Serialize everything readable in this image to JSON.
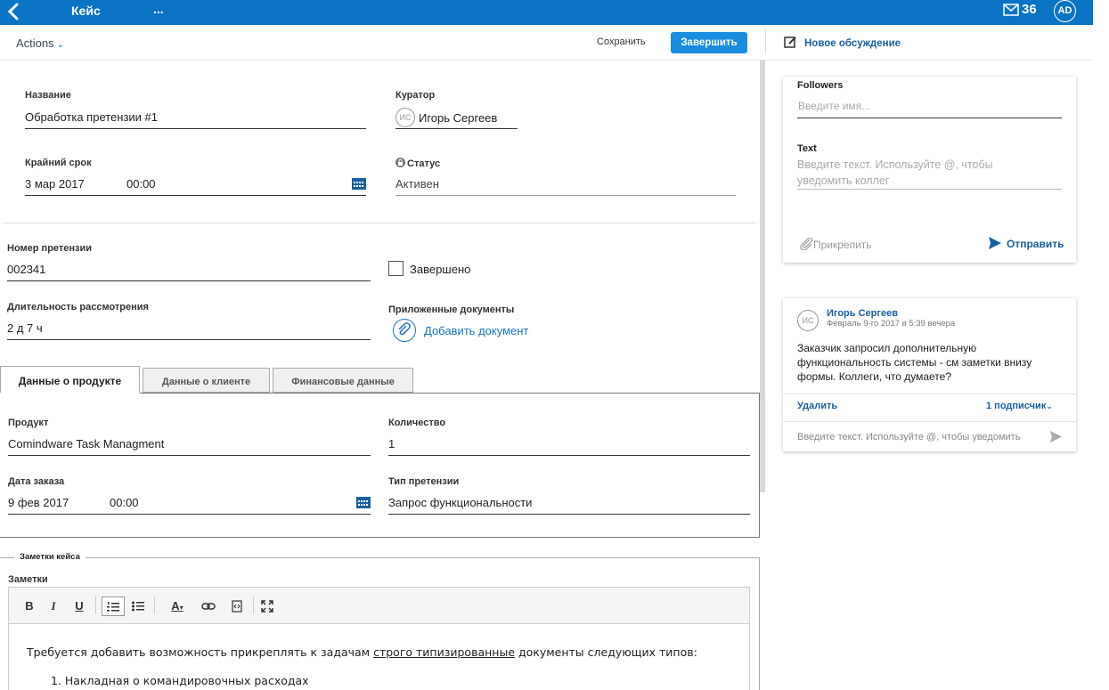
{
  "header": {
    "title": "Кейс",
    "more": "...",
    "mail_count": "36",
    "user_initials": "AD"
  },
  "toolbar": {
    "actions_label": "Actions",
    "save_label": "Сохранить",
    "finish_label": "Завершить",
    "new_discussion_label": "Новое обсуждение"
  },
  "form": {
    "name_label": "Название",
    "name_value": "Обработка претензии #1",
    "curator_label": "Куратор",
    "curator_initials": "ИС",
    "curator_value": "Игорь Сергеев",
    "deadline_label": "Крайний срок",
    "deadline_date": "3 мар 2017",
    "deadline_time": "00:00",
    "status_label": "Статус",
    "status_value": "Активен",
    "claim_number_label": "Номер претензии",
    "claim_number_value": "002341",
    "completed_label": "Завершено",
    "duration_label": "Длительность рассмотрения",
    "duration_value": "2 д 7 ч",
    "attached_docs_label": "Приложенные документы",
    "add_document_label": "Добавить документ"
  },
  "tabs": [
    {
      "label": "Данные о продукте"
    },
    {
      "label": "Данные о клиенте"
    },
    {
      "label": "Финансовые данные"
    }
  ],
  "product_tab": {
    "product_label": "Продукт",
    "product_value": "Comindware Task Managment",
    "quantity_label": "Количество",
    "quantity_value": "1",
    "order_date_label": "Дата заказа",
    "order_date": "9 фев 2017",
    "order_time": "00:00",
    "claim_type_label": "Тип претензии",
    "claim_type_value": "Запрос функциональности"
  },
  "notes": {
    "legend": "Заметки кейса",
    "label": "Заметки",
    "text_before": "Требуется добавить возможность прикреплять к задачам ",
    "text_underlined": "строго типизированные",
    "text_after": " документы следующих типов:",
    "list_item_1": "1. Накладная о командировочных расходах"
  },
  "discussion": {
    "followers_label": "Followers",
    "followers_placeholder": "Введите имя...",
    "text_label": "Text",
    "text_placeholder_1": "Введите текст. Используйте @, чтобы",
    "text_placeholder_2": "уведомить коллег",
    "attach_label": "Прикрепить",
    "send_label": "Отправить"
  },
  "comment": {
    "author_initials": "ИС",
    "author": "Игорь Сергеев",
    "date": "Февраль 9-го 2017 в 5:39 вечера",
    "line1": "Заказчик запросил дополнительную",
    "line2": "функциональность системы - см заметки внизу",
    "line3": "формы. Коллеги, что думаете?",
    "delete_label": "Удалить",
    "subscribers_label": "1 подписчик",
    "reply_placeholder": "Введите текст. Используйте @, чтобы уведомить"
  },
  "colors": {
    "brand_blue": "#0a73c4",
    "button_blue": "#1a8de0",
    "link_blue": "#1a5fa0"
  }
}
